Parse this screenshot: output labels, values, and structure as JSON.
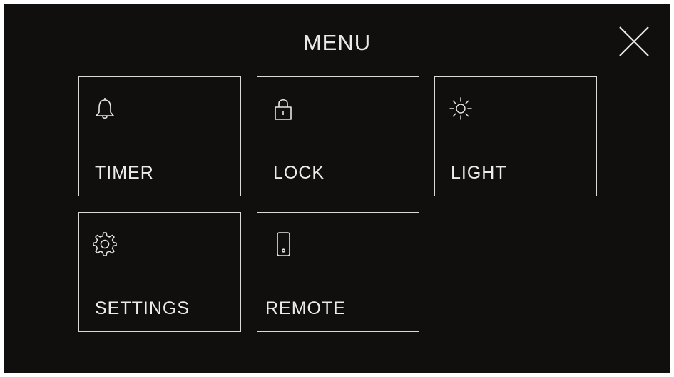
{
  "header": {
    "title": "MENU",
    "close_icon": "close-icon"
  },
  "colors": {
    "background": "#110f0e",
    "foreground": "#e9e9e9",
    "tile_border": "#d9d9d9"
  },
  "tiles": [
    {
      "label": "TIMER",
      "icon": "bell-icon"
    },
    {
      "label": "LOCK",
      "icon": "padlock-icon"
    },
    {
      "label": "LIGHT",
      "icon": "sun-icon"
    },
    {
      "label": "SETTINGS",
      "icon": "gear-icon"
    },
    {
      "label": "REMOTE",
      "icon": "phone-icon"
    }
  ]
}
